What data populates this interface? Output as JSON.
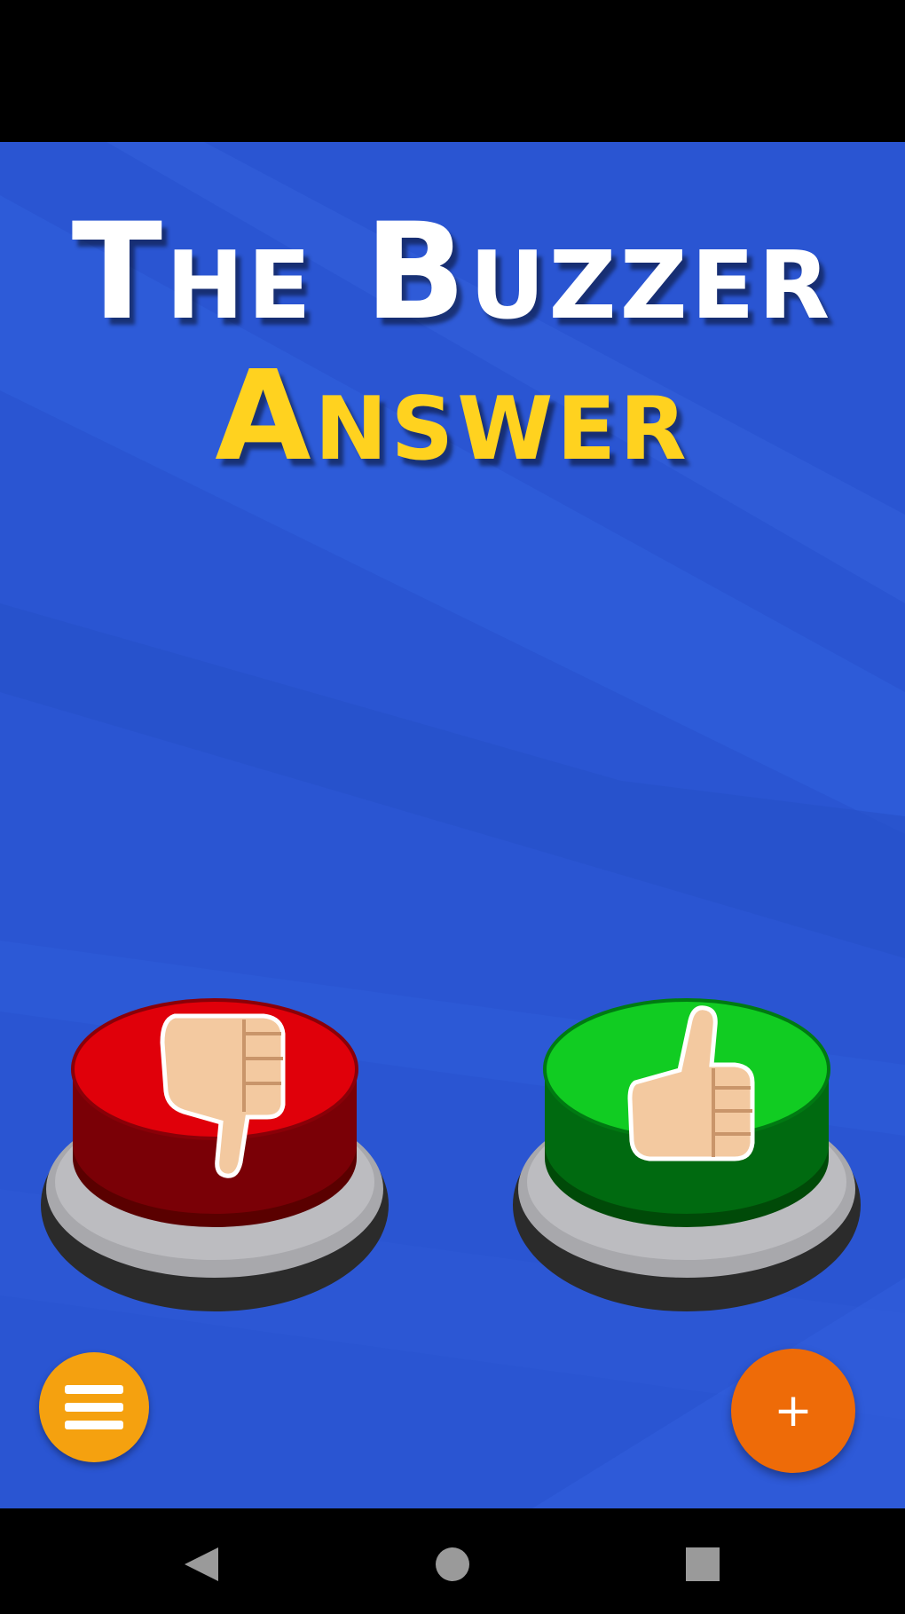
{
  "app": {
    "title_line1": "The Buzzer",
    "title_line2": "Answer"
  },
  "buttons": {
    "no_buzzer": {
      "icon": "thumbs-down-icon",
      "color": "#e0000a"
    },
    "yes_buzzer": {
      "icon": "thumbs-up-icon",
      "color": "#11cc22"
    },
    "menu": {
      "icon": "hamburger-menu-icon",
      "color": "#f5a10f"
    },
    "add": {
      "icon": "plus-icon",
      "label": "+",
      "color": "#ee6b08"
    }
  },
  "nav": {
    "back": "back-triangle-icon",
    "home": "home-circle-icon",
    "recents": "recents-square-icon"
  },
  "colors": {
    "background": "#2a55d2",
    "title_primary": "#ffffff",
    "title_accent": "#ffd21f"
  }
}
